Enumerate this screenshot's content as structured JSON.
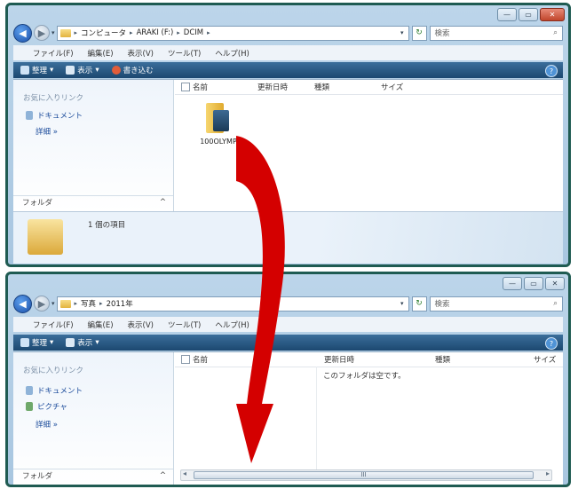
{
  "window1": {
    "controls": {
      "minimize": "—",
      "maximize": "▭",
      "close": "✕"
    },
    "breadcrumb": [
      "コンピュータ",
      "ARAKI (F:)",
      "DCIM"
    ],
    "search_placeholder": "検索",
    "menu": [
      "ファイル(F)",
      "編集(E)",
      "表示(V)",
      "ツール(T)",
      "ヘルプ(H)"
    ],
    "commands": [
      "整理",
      "表示",
      "書き込む"
    ],
    "favorites_heading": "お気に入りリンク",
    "favorite_links": [
      "ドキュメント"
    ],
    "more_label": "詳細 »",
    "folders_label": "フォルダ",
    "columns": [
      "名前",
      "更新日時",
      "種類",
      "サイズ"
    ],
    "items": [
      {
        "name": "100OLYMP"
      }
    ],
    "details_text": "1 個の項目"
  },
  "window2": {
    "controls": {
      "minimize": "—",
      "maximize": "▭",
      "close": "✕"
    },
    "breadcrumb": [
      "写真",
      "2011年"
    ],
    "search_placeholder": "検索",
    "menu": [
      "ファイル(F)",
      "編集(E)",
      "表示(V)",
      "ツール(T)",
      "ヘルプ(H)"
    ],
    "commands": [
      "整理",
      "表示"
    ],
    "favorites_heading": "お気に入りリンク",
    "favorite_links": [
      "ドキュメント",
      "ピクチャ"
    ],
    "more_label": "詳細 »",
    "folders_label": "フォルダ",
    "columns": [
      "名前",
      "更新日時",
      "種類",
      "サイズ"
    ],
    "empty_text": "このフォルダは空です。"
  },
  "icons": {
    "back": "◀",
    "forward": "▶",
    "dropdown": "▾",
    "refresh": "↻",
    "search": "⌕",
    "help": "?",
    "collapse": "^",
    "scroll_left": "◂",
    "scroll_right": "▸",
    "scroll_grip": "III"
  },
  "arrow_color": "#d40000"
}
